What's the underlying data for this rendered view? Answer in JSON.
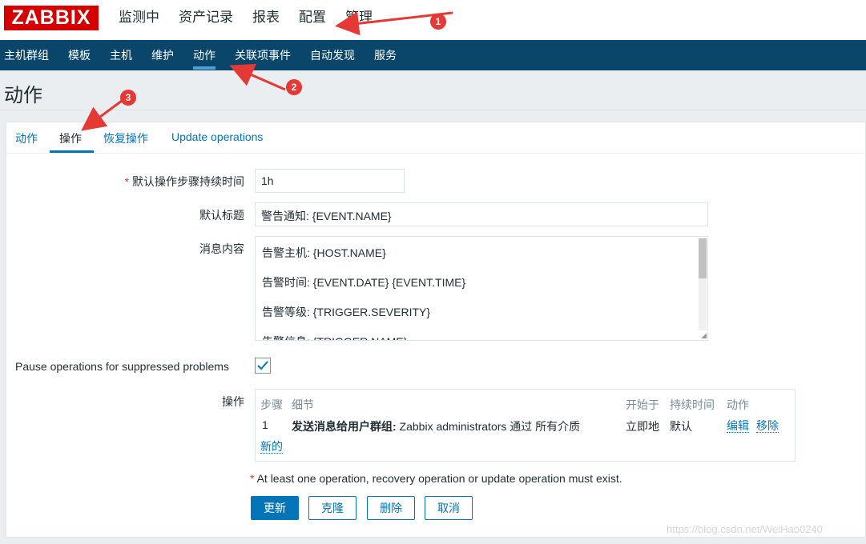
{
  "header": {
    "logo": "ZABBIX",
    "top_menu": [
      "监测中",
      "资产记录",
      "报表",
      "配置",
      "管理"
    ],
    "sub_menu": [
      "主机群组",
      "模板",
      "主机",
      "维护",
      "动作",
      "关联项事件",
      "自动发现",
      "服务"
    ],
    "active_sub": "动作"
  },
  "page": {
    "title": "动作"
  },
  "tabs": [
    "动作",
    "操作",
    "恢复操作",
    "Update operations"
  ],
  "form": {
    "step_duration": {
      "required_mark": "*",
      "label": "默认操作步骤持续时间",
      "value": "1h"
    },
    "default_subject": {
      "label": "默认标题",
      "value": "警告通知: {EVENT.NAME}"
    },
    "message": {
      "label": "消息内容",
      "lines": [
        "告警主机: {HOST.NAME}",
        "告警时间: {EVENT.DATE} {EVENT.TIME}",
        "告警等级: {TRIGGER.SEVERITY}",
        "告警信息: {TRIGGER.NAME}"
      ]
    },
    "pause_label": "Pause operations for suppressed problems",
    "pause_checked": true,
    "operations": {
      "label": "操作",
      "columns": [
        "步骤",
        "细节",
        "开始于",
        "持续时间",
        "动作"
      ],
      "row": {
        "step": "1",
        "detail_bold": "发送消息给用户群组:",
        "detail_rest": " Zabbix administrators 通过 所有介质",
        "start": "立即地",
        "duration": "默认",
        "edit": "编辑",
        "remove": "移除"
      },
      "new_link": "新的"
    },
    "note_mark": "*",
    "note": "At least one operation, recovery operation or update operation must exist."
  },
  "buttons": {
    "update": "更新",
    "clone": "克隆",
    "delete": "删除",
    "cancel": "取消"
  },
  "annotations": {
    "badge1": "1",
    "badge2": "2",
    "badge3": "3",
    "arrow_color": "#e53935"
  },
  "watermark": "https://blog.csdn.net/WeiHao0240"
}
